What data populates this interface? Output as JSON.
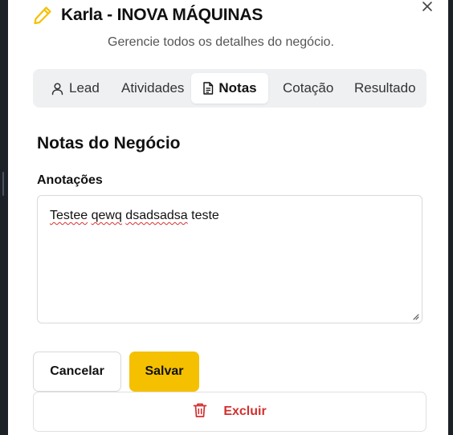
{
  "dialog": {
    "title": "Karla - INOVA MÁQUINAS",
    "subtitle": "Gerencie todos os detalhes do negócio.",
    "title_icon": "pencil-icon",
    "close_icon": "close-icon"
  },
  "tabs": [
    {
      "label": "Lead",
      "icon": "user-icon",
      "active": false
    },
    {
      "label": "Atividades",
      "icon": "",
      "active": false
    },
    {
      "label": "Notas",
      "icon": "file-text-icon",
      "active": true
    },
    {
      "label": "Cotação",
      "icon": "",
      "active": false
    },
    {
      "label": "Resultado",
      "icon": "",
      "active": false
    }
  ],
  "notes": {
    "section_title": "Notas do Negócio",
    "field_label": "Anotações",
    "text_parts": [
      "Testee",
      "qewq",
      "dsadsadsa",
      "teste"
    ]
  },
  "actions": {
    "cancel_label": "Cancelar",
    "save_label": "Salvar",
    "delete_label": "Excluir",
    "delete_icon": "trash-icon"
  },
  "colors": {
    "accent": "#f5c000",
    "danger": "#d32f2f",
    "tabs_bg": "#eef0f2"
  }
}
